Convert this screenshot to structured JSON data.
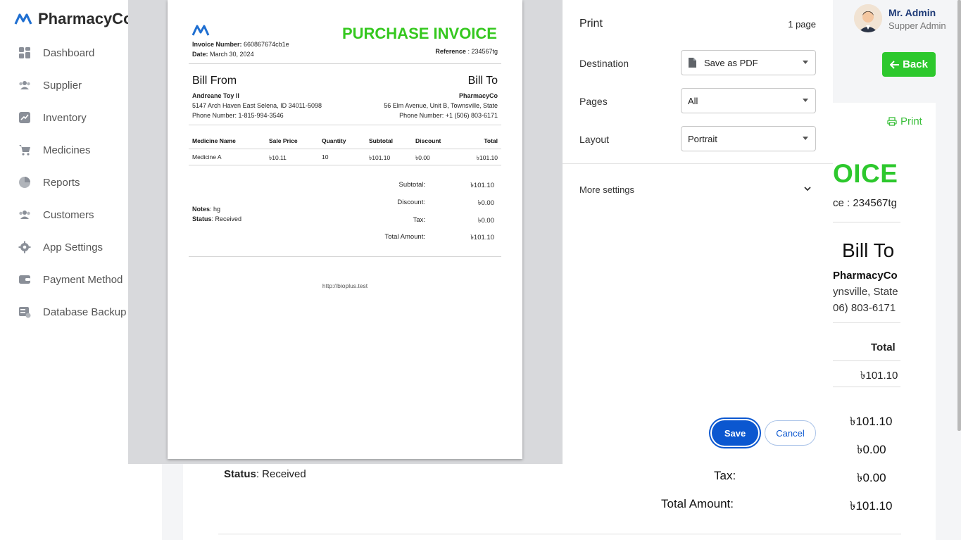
{
  "app": {
    "brand": "PharmacyCo",
    "sidebar": [
      {
        "label": "Dashboard",
        "icon": "dashboard-icon"
      },
      {
        "label": "Supplier",
        "icon": "supplier-icon"
      },
      {
        "label": "Inventory",
        "icon": "inventory-icon"
      },
      {
        "label": "Medicines",
        "icon": "cart-icon"
      },
      {
        "label": "Reports",
        "icon": "pie-chart-icon"
      },
      {
        "label": "Customers",
        "icon": "customers-icon"
      },
      {
        "label": "App Settings",
        "icon": "gear-icon"
      },
      {
        "label": "Payment Method",
        "icon": "wallet-icon"
      },
      {
        "label": "Database Backup",
        "icon": "database-icon"
      }
    ],
    "user": {
      "name": "Mr. Admin",
      "role": "Supper Admin"
    },
    "back_label": "Back",
    "print_label": "Print",
    "bg": {
      "title_fragment": "OICE",
      "reference_fragment": "ce : 234567tg",
      "bill_to": "Bill To",
      "company": "PharmacyCo",
      "address_fragment": "ynsville, State",
      "phone_fragment": "06) 803-6171",
      "total_header": "Total",
      "total_value": "৳101.10",
      "sum_subtotal": "৳101.10",
      "sum_discount": "৳0.00",
      "tax_label": "Tax:",
      "tax_value": "৳0.00",
      "total_amount_label": "Total Amount:",
      "total_amount_value": "৳101.10",
      "status_label": "Status",
      "status_value": ": Received"
    }
  },
  "invoice": {
    "title": "PURCHASE INVOICE",
    "number_label": "Invoice Number:",
    "number": "660867674cb1e",
    "date_label": "Date:",
    "date": "March 30, 2024",
    "reference_label": "Reference",
    "reference": ": 234567tg",
    "bill_from": {
      "heading": "Bill From",
      "name": "Andreane Toy II",
      "address": "5147 Arch Haven East Selena, ID 34011-5098",
      "phone": "Phone Number: 1-815-994-3546"
    },
    "bill_to": {
      "heading": "Bill To",
      "name": "PharmacyCo",
      "address": "56 Elm Avenue, Unit B, Townsville, State",
      "phone": "Phone Number: +1 (506) 803-6171"
    },
    "columns": [
      "Medicine Name",
      "Sale Price",
      "Quantity",
      "Subtotal",
      "Discount",
      "Total"
    ],
    "rows": [
      [
        "Medicine A",
        "৳10.11",
        "10",
        "৳101.10",
        "৳0.00",
        "৳101.10"
      ]
    ],
    "notes_label": "Notes",
    "notes": ": hg",
    "status_label": "Status",
    "status": ": Received",
    "summary": [
      {
        "label": "Subtotal:",
        "value": "৳101.10"
      },
      {
        "label": "Discount:",
        "value": "৳0.00"
      },
      {
        "label": "Tax:",
        "value": "৳0.00"
      },
      {
        "label": "Total Amount:",
        "value": "৳101.10"
      }
    ],
    "footer_url": "http://bioplus.test"
  },
  "print_dialog": {
    "title": "Print",
    "page_count": "1 page",
    "destination_label": "Destination",
    "destination_value": "Save as PDF",
    "pages_label": "Pages",
    "pages_value": "All",
    "layout_label": "Layout",
    "layout_value": "Portrait",
    "more_settings": "More settings",
    "save": "Save",
    "cancel": "Cancel",
    "accent": "#0b57d0"
  }
}
